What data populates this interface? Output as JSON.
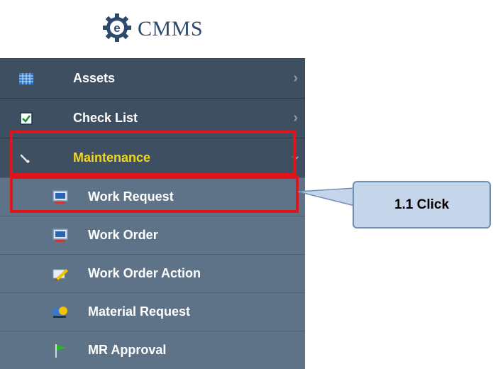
{
  "logo": {
    "text": "CMMS",
    "icon": "e-gear-logo"
  },
  "menu": {
    "items": [
      {
        "label": "Assets",
        "icon": "grid-icon"
      },
      {
        "label": "Check List",
        "icon": "checkbox-icon"
      },
      {
        "label": "Maintenance",
        "icon": "wrench-icon"
      }
    ],
    "sub_items": [
      {
        "label": "Work Request",
        "icon": "monitor-icon"
      },
      {
        "label": "Work Order",
        "icon": "monitor-icon"
      },
      {
        "label": "Work Order Action",
        "icon": "pencil-icon"
      },
      {
        "label": "Material Request",
        "icon": "materials-icon"
      },
      {
        "label": "MR Approval",
        "icon": "flag-icon"
      }
    ]
  },
  "callout": {
    "text": "1.1 Click"
  },
  "colors": {
    "accent": "#f1d81f",
    "highlight": "#e0141a",
    "callout_fill": "#c5d6ea"
  }
}
